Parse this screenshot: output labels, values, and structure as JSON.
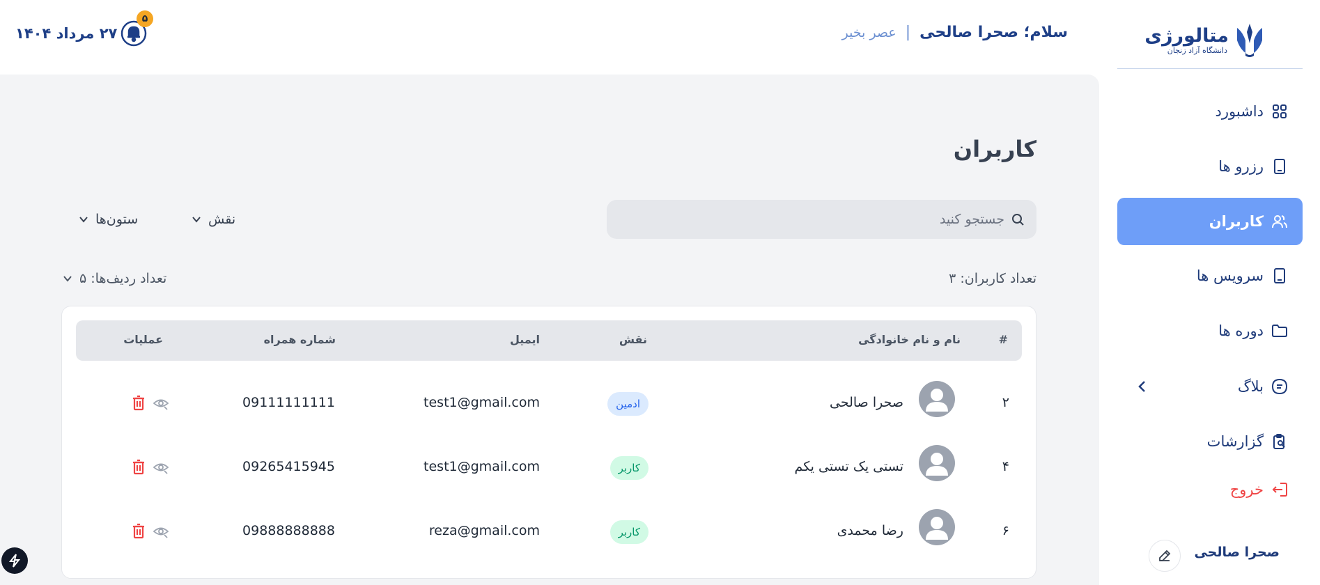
{
  "brand": {
    "title": "متالورژی",
    "subtitle": "دانشگاه آزاد زنجان"
  },
  "sidebar": {
    "items": [
      {
        "label": "داشبورد",
        "icon": "grid-icon"
      },
      {
        "label": "رزرو ها",
        "icon": "tablet-icon"
      },
      {
        "label": "کاربران",
        "icon": "users-icon",
        "active": true
      },
      {
        "label": "سرویس ها",
        "icon": "tablet-icon"
      },
      {
        "label": "دوره ها",
        "icon": "folder-icon"
      },
      {
        "label": "بلاگ",
        "icon": "blog-icon"
      },
      {
        "label": "گزارشات",
        "icon": "clipboard-search-icon"
      },
      {
        "label": "خروج",
        "icon": "logout-icon"
      }
    ],
    "user_name": "صحرا صالحی"
  },
  "header": {
    "greeting": "سلام؛ صحرا صالحی",
    "separator": "|",
    "time_of_day": "عصر بخیر",
    "date": "۲۷ مرداد ۱۴۰۴",
    "notification_count": "۵"
  },
  "main": {
    "title": "کاربران",
    "search_placeholder": "جستجو کنید",
    "filter_role": "نقش",
    "filter_columns": "ستون‌ها",
    "user_count": "تعداد کاربران: ۳",
    "rows_per_page": "تعداد ردیف‌ها: ۵"
  },
  "table": {
    "headers": {
      "index": "#",
      "name": "نام و نام خانوادگی",
      "role": "نقش",
      "email": "ایمیل",
      "phone": "شماره همراه",
      "actions": "عملیات"
    },
    "rows": [
      {
        "index": "۲",
        "name": "صحرا صالحی",
        "role": "ادمین",
        "role_type": "admin",
        "email": "test1@gmail.com",
        "phone": "09111111111"
      },
      {
        "index": "۴",
        "name": "تستی یک تستی یکم",
        "role": "کاربر",
        "role_type": "user",
        "email": "test1@gmail.com",
        "phone": "09265415945"
      },
      {
        "index": "۶",
        "name": "رضا محمدی",
        "role": "کاربر",
        "role_type": "user",
        "email": "reza@gmail.com",
        "phone": "09888888888"
      }
    ]
  },
  "colors": {
    "primary": "#6e9ef8",
    "brand": "#1e3f87",
    "danger": "#ef4444",
    "badge_admin_bg": "#dbeafe",
    "badge_user_bg": "#d1fae5"
  }
}
